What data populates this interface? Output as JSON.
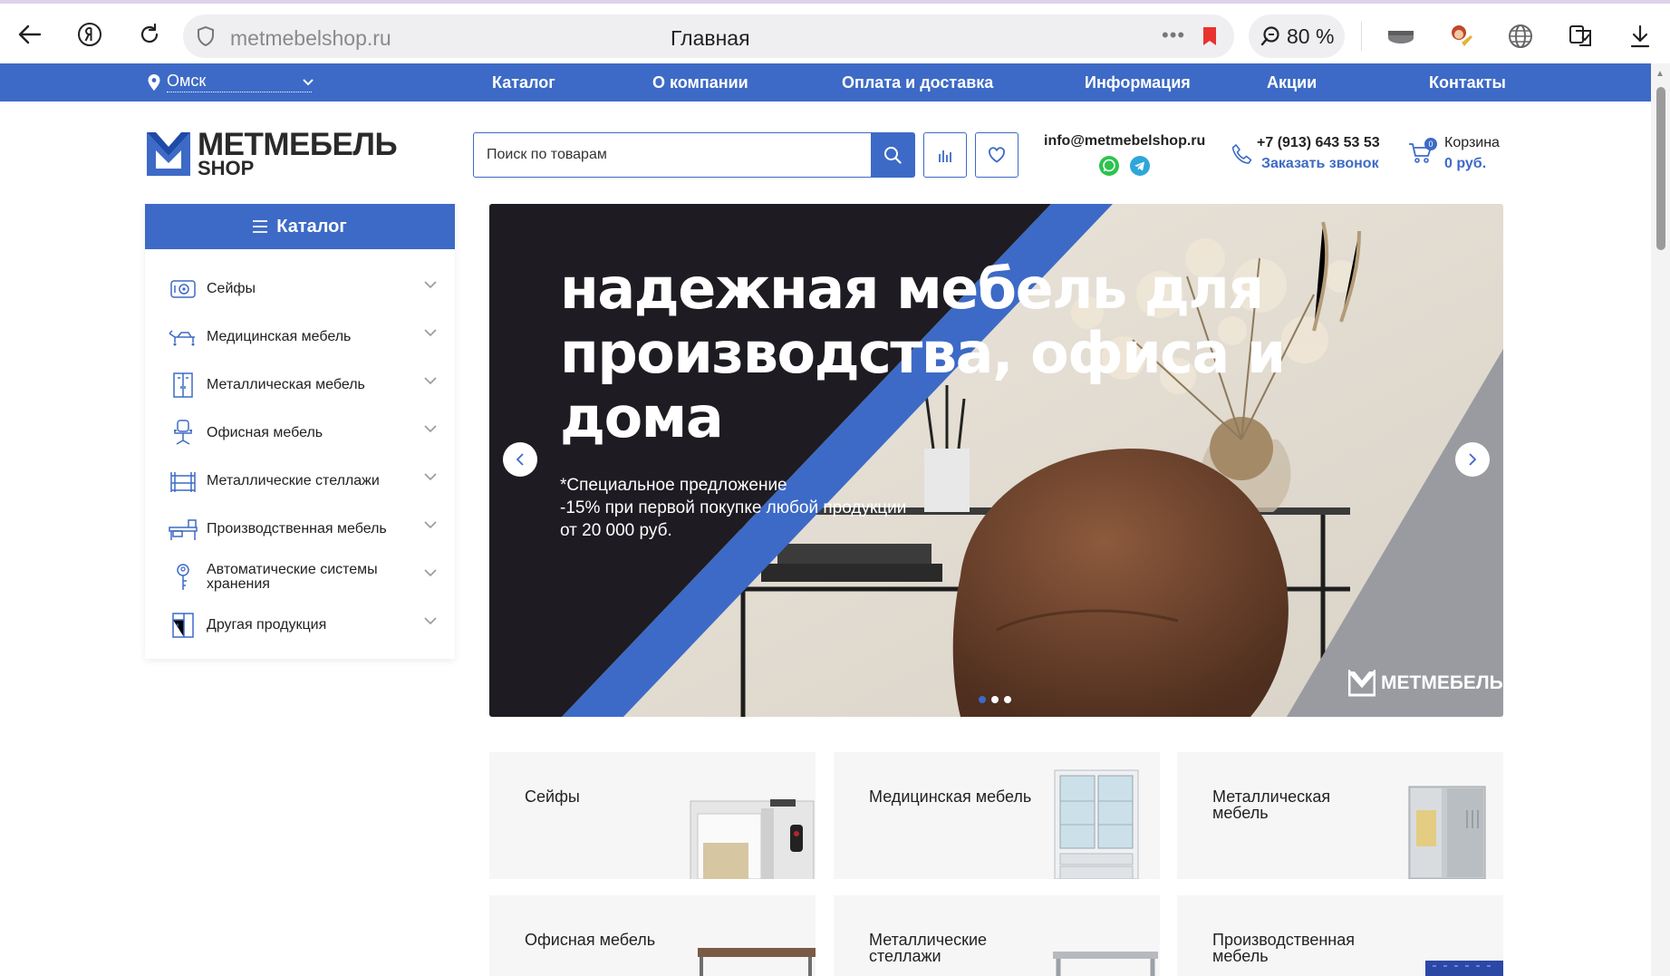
{
  "browser": {
    "url": "metmebelshop.ru",
    "tab_title": "Главная",
    "zoom": "80 %"
  },
  "site": {
    "city": "Омск",
    "nav": [
      "Каталог",
      "О компании",
      "Оплата и доставка",
      "Информация",
      "Акции",
      "Контакты"
    ],
    "logo": {
      "line1": "МЕТМЕБЕЛЬ",
      "line2": "SHOP"
    },
    "search_placeholder": "Поиск по товарам",
    "email": "info@metmebelshop.ru",
    "phone": "+7 (913) 643 53 53",
    "callback": "Заказать звонок",
    "cart": {
      "label": "Корзина",
      "sum": "0 руб.",
      "count": "0"
    }
  },
  "catalog": {
    "title": "Каталог",
    "items": [
      {
        "label": "Сейфы",
        "icon": "safe-icon"
      },
      {
        "label": "Медицинская мебель",
        "icon": "medical-bed-icon"
      },
      {
        "label": "Металлическая мебель",
        "icon": "locker-icon"
      },
      {
        "label": "Офисная мебель",
        "icon": "office-chair-icon"
      },
      {
        "label": "Металлические стеллажи",
        "icon": "rack-icon"
      },
      {
        "label": "Производственная мебель",
        "icon": "workbench-icon"
      },
      {
        "label": "Автоматические системы хранения",
        "icon": "key-icon"
      },
      {
        "label": "Другая продукция",
        "icon": "cabinet-icon"
      }
    ]
  },
  "hero": {
    "headline": "надежная мебель для производства, офиса и дома",
    "promo_line1": "*Специальное предложение",
    "promo_line2": "-15% при первой покупке любой продукции",
    "promo_line3": "от 20 000 руб.",
    "brand": "МЕТМЕБЕЛЬ",
    "slide_count": 3,
    "active_slide": 1
  },
  "cards": [
    {
      "title": "Сейфы"
    },
    {
      "title": "Медицинская мебель"
    },
    {
      "title": "Металлическая мебель"
    },
    {
      "title": "Офисная мебель"
    },
    {
      "title": "Металлические стеллажи"
    },
    {
      "title": "Производственная мебель"
    }
  ],
  "colors": {
    "brand_blue": "#3d6ac6",
    "dark": "#1e1c22"
  }
}
